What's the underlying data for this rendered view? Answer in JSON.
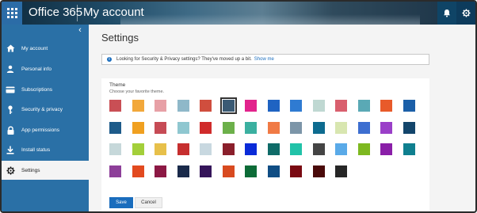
{
  "header": {
    "app_title": "Office 365",
    "page_name": "My account"
  },
  "sidebar": {
    "items": [
      {
        "label": "My account",
        "icon": "home-icon",
        "active": false
      },
      {
        "label": "Personal info",
        "icon": "person-icon",
        "active": false
      },
      {
        "label": "Subscriptions",
        "icon": "card-icon",
        "active": false
      },
      {
        "label": "Security & privacy",
        "icon": "key-icon",
        "active": false
      },
      {
        "label": "App permissions",
        "icon": "lock-icon",
        "active": false
      },
      {
        "label": "Install status",
        "icon": "download-icon",
        "active": false
      },
      {
        "label": "Settings",
        "icon": "gear-icon",
        "active": true
      }
    ]
  },
  "main": {
    "title": "Settings",
    "info_text": "Looking for Security & Privacy settings? They've moved up a bit.",
    "info_link": "Show me",
    "theme_heading": "Theme",
    "theme_subheading": "Choose your favorite theme.",
    "themes": [
      {
        "color": "#c94f55",
        "selected": false
      },
      {
        "color": "#f2a83b",
        "selected": false
      },
      {
        "color": "#e7a0a6",
        "selected": false
      },
      {
        "color": "#8fb8c9",
        "selected": false
      },
      {
        "color": "#d04e3e",
        "selected": false
      },
      {
        "color": "#3a5a74",
        "selected": true
      },
      {
        "color": "#e2238c",
        "selected": false
      },
      {
        "color": "#1f63c2",
        "selected": false
      },
      {
        "color": "#2f7bd2",
        "selected": false
      },
      {
        "color": "#bfd8d2",
        "selected": false
      },
      {
        "color": "#d95f6e",
        "selected": false
      },
      {
        "color": "#5aa9b5",
        "selected": false
      },
      {
        "color": "#e85a2a",
        "selected": false
      },
      {
        "color": "#1b5fa8",
        "selected": false
      },
      {
        "color": "#1d5b8a",
        "selected": false
      },
      {
        "color": "#f0a020",
        "selected": false
      },
      {
        "color": "#c64b55",
        "selected": false
      },
      {
        "color": "#8fc7d0",
        "selected": false
      },
      {
        "color": "#d02b2b",
        "selected": false
      },
      {
        "color": "#6cb04a",
        "selected": false
      },
      {
        "color": "#3bb0a0",
        "selected": false
      },
      {
        "color": "#f07a45",
        "selected": false
      },
      {
        "color": "#7c95a8",
        "selected": false
      },
      {
        "color": "#0d6b8f",
        "selected": false
      },
      {
        "color": "#d8e6b0",
        "selected": false
      },
      {
        "color": "#3d6ed0",
        "selected": false
      },
      {
        "color": "#9a3fc8",
        "selected": false
      },
      {
        "color": "#13456b",
        "selected": false
      },
      {
        "color": "#c6d8da",
        "selected": false
      },
      {
        "color": "#a3cf3a",
        "selected": false
      },
      {
        "color": "#e7c04a",
        "selected": false
      },
      {
        "color": "#c62f2f",
        "selected": false
      },
      {
        "color": "#c8d8e0",
        "selected": false
      },
      {
        "color": "#8a1f2b",
        "selected": false
      },
      {
        "color": "#0a2bd8",
        "selected": false
      },
      {
        "color": "#0f6b68",
        "selected": false
      },
      {
        "color": "#21c2a8",
        "selected": false
      },
      {
        "color": "#444444",
        "selected": false
      },
      {
        "color": "#5aaae8",
        "selected": false
      },
      {
        "color": "#7db820",
        "selected": false
      },
      {
        "color": "#8a1fa8",
        "selected": false
      },
      {
        "color": "#0f7f8f",
        "selected": false
      },
      {
        "color": "#8d3f99",
        "selected": false
      },
      {
        "color": "#e24a1f",
        "selected": false
      },
      {
        "color": "#8c1844",
        "selected": false
      },
      {
        "color": "#1a2a4a",
        "selected": false
      },
      {
        "color": "#35155a",
        "selected": false
      },
      {
        "color": "#d84a20",
        "selected": false
      },
      {
        "color": "#0c6b37",
        "selected": false
      },
      {
        "color": "#0f4d84",
        "selected": false
      },
      {
        "color": "#7a0a12",
        "selected": false
      },
      {
        "color": "#4a0a0a",
        "selected": false
      },
      {
        "color": "#262626",
        "selected": false
      }
    ],
    "save_label": "Save",
    "cancel_label": "Cancel"
  }
}
